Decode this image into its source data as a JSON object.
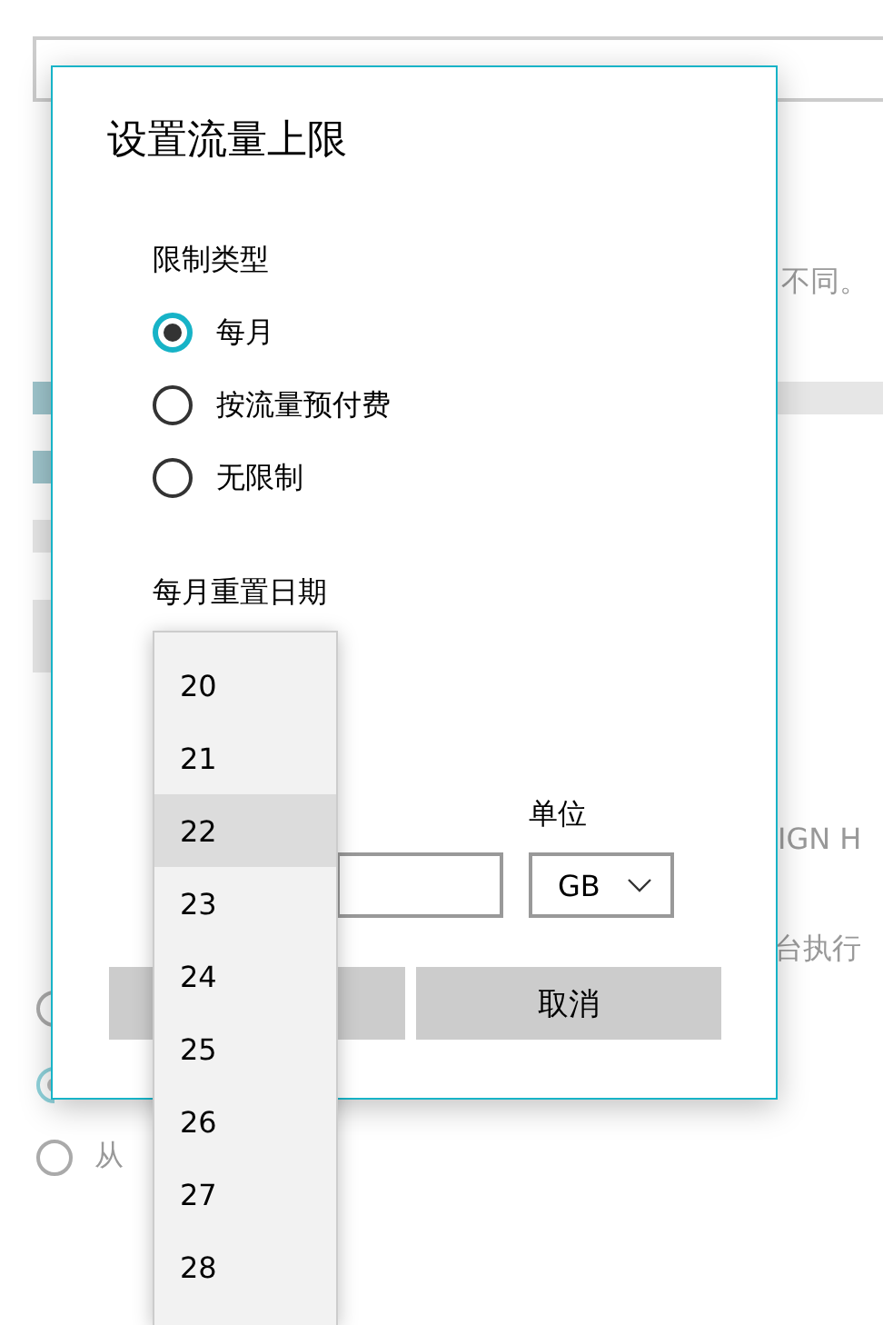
{
  "background": {
    "fragments": [
      {
        "text": "不同。"
      },
      {
        "text": "IGN H"
      },
      {
        "text": "台执行"
      }
    ],
    "radios": [
      {
        "selected": false
      },
      {
        "selected": true
      },
      {
        "selected": false,
        "label": "从"
      }
    ]
  },
  "dialog": {
    "title": "设置流量上限",
    "limit_type_label": "限制类型",
    "options": [
      {
        "label": "每月",
        "selected": true
      },
      {
        "label": "按流量预付费",
        "selected": false
      },
      {
        "label": "无限制",
        "selected": false
      }
    ],
    "reset_date_label": "每月重置日期",
    "unit_label": "单位",
    "unit_value": "GB",
    "cancel_button": "取消"
  },
  "day_dropdown": [
    {
      "label": "20",
      "selected": false
    },
    {
      "label": "21",
      "selected": false
    },
    {
      "label": "22",
      "selected": true
    },
    {
      "label": "23",
      "selected": false
    },
    {
      "label": "24",
      "selected": false
    },
    {
      "label": "25",
      "selected": false
    },
    {
      "label": "26",
      "selected": false
    },
    {
      "label": "27",
      "selected": false
    },
    {
      "label": "28",
      "selected": false
    }
  ]
}
